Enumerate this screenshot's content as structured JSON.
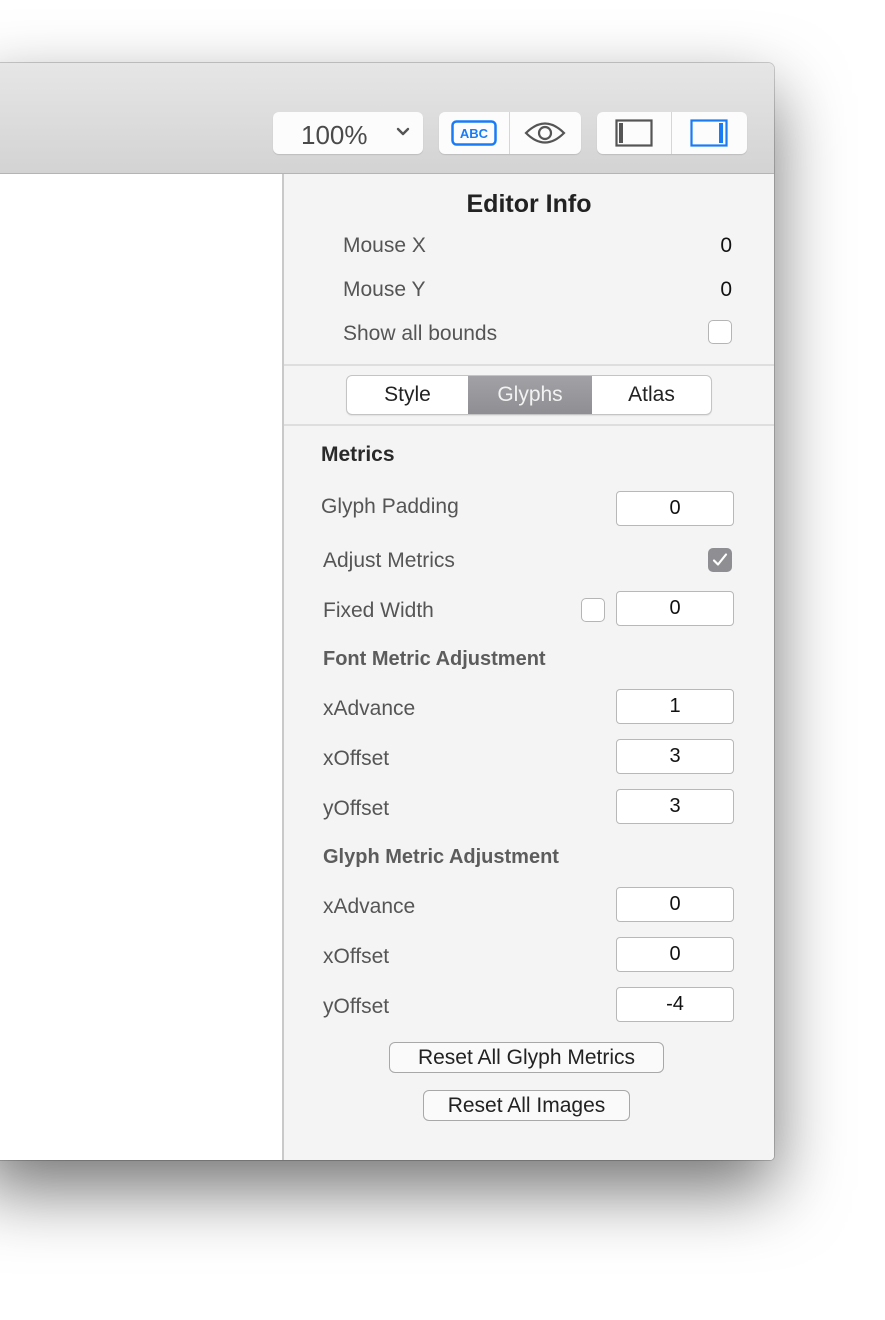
{
  "toolbar": {
    "zoom_value": "100%",
    "zoom_chevron_icon": "chevron-down-icon",
    "text_preview_icon": "abc-icon",
    "text_preview_label": "ABC",
    "preview_icon": "eye-icon",
    "left_panel_icon": "left-sidebar-icon",
    "right_panel_icon": "right-sidebar-icon",
    "accent_color": "#1a7cf5"
  },
  "inspector": {
    "title": "Editor Info",
    "mouse_x_label": "Mouse X",
    "mouse_x_value": "0",
    "mouse_y_label": "Mouse Y",
    "mouse_y_value": "0",
    "show_bounds_label": "Show all bounds",
    "show_bounds_checked": false,
    "tabs": [
      {
        "label": "Style",
        "active": false
      },
      {
        "label": "Glyphs",
        "active": true
      },
      {
        "label": "Atlas",
        "active": false
      }
    ],
    "metrics": {
      "heading": "Metrics",
      "glyph_padding_label": "Glyph Padding",
      "glyph_padding_value": "0",
      "adjust_metrics_label": "Adjust Metrics",
      "adjust_metrics_checked": true,
      "fixed_width_label": "Fixed Width",
      "fixed_width_checked": false,
      "fixed_width_value": "0"
    },
    "font_metric": {
      "heading": "Font Metric Adjustment",
      "rows": [
        {
          "label": "xAdvance",
          "value": "1"
        },
        {
          "label": "xOffset",
          "value": "3"
        },
        {
          "label": "yOffset",
          "value": "3"
        }
      ]
    },
    "glyph_metric": {
      "heading": "Glyph Metric Adjustment",
      "rows": [
        {
          "label": "xAdvance",
          "value": "0"
        },
        {
          "label": "xOffset",
          "value": "0"
        },
        {
          "label": "yOffset",
          "value": "-4"
        }
      ]
    },
    "reset_glyph_metrics_label": "Reset All Glyph Metrics",
    "reset_images_label": "Reset All Images"
  }
}
